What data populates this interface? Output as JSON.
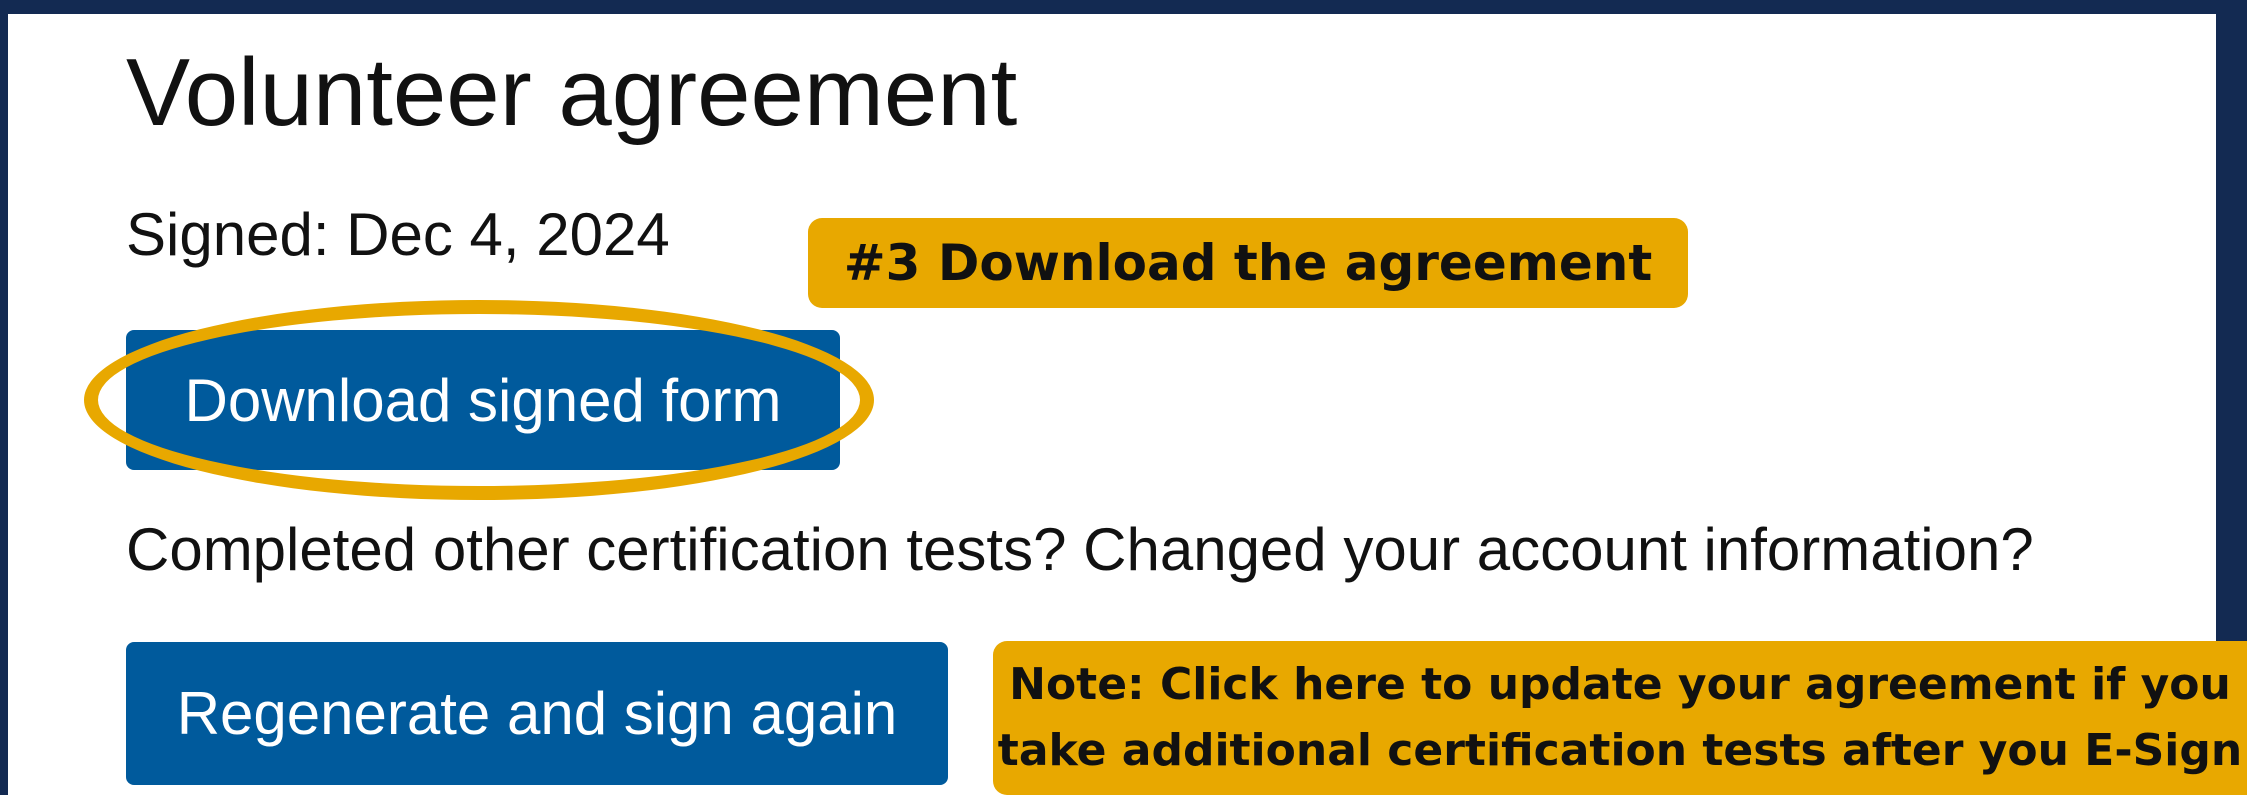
{
  "heading": {
    "title": "Volunteer agreement",
    "signed_text": "Signed: Dec 4, 2024"
  },
  "actions": {
    "download_label": "Download signed form",
    "prompt_text": "Completed other certification tests? Changed your account information?",
    "regenerate_label": "Regenerate and sign again"
  },
  "annotations": {
    "step_label": "#3 Download the agreement",
    "note_line1": "Note: Click here to update your agreement if you",
    "note_line2": "take additional certification tests after you E-Sign"
  },
  "colors": {
    "background": "#132a52",
    "panel": "#ffffff",
    "button": "#005a9c",
    "annotation": "#e8a800"
  }
}
